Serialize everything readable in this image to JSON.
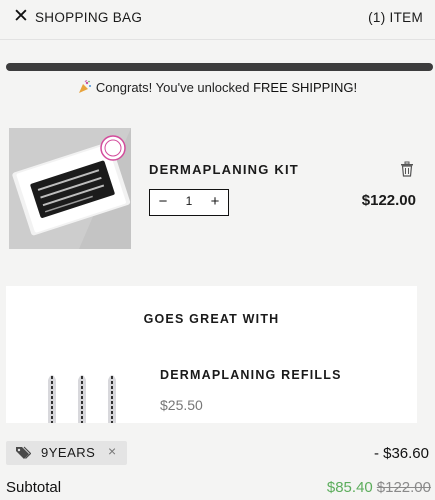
{
  "header": {
    "close_icon": "close-icon",
    "title": "SHOPPING BAG",
    "item_count": "(1) ITEM"
  },
  "shipping": {
    "progress_fraction": 1.0,
    "message_prefix": "Congrats! You've unlocked ",
    "message_highlight": "FREE SHIPPING!",
    "icon": "party-popper-icon"
  },
  "cart_item": {
    "name": "DERMAPLANING KIT",
    "quantity": "1",
    "price": "$122.00",
    "minus_label": "−",
    "plus_label": "+",
    "remove_icon": "trash-icon"
  },
  "upsell": {
    "title": "GOES GREAT WITH",
    "product_name": "DERMAPLANING REFILLS",
    "product_price": "$25.50"
  },
  "summary": {
    "discount_code": "9YEARS",
    "discount_remove_label": "×",
    "discount_amount": "- $36.60",
    "subtotal_label": "Subtotal",
    "subtotal_new": "$85.40",
    "subtotal_old": "$122.00"
  },
  "colors": {
    "accent_green": "#5cad5c",
    "progress": "#3c3c3d",
    "background": "#f4f4f3"
  }
}
